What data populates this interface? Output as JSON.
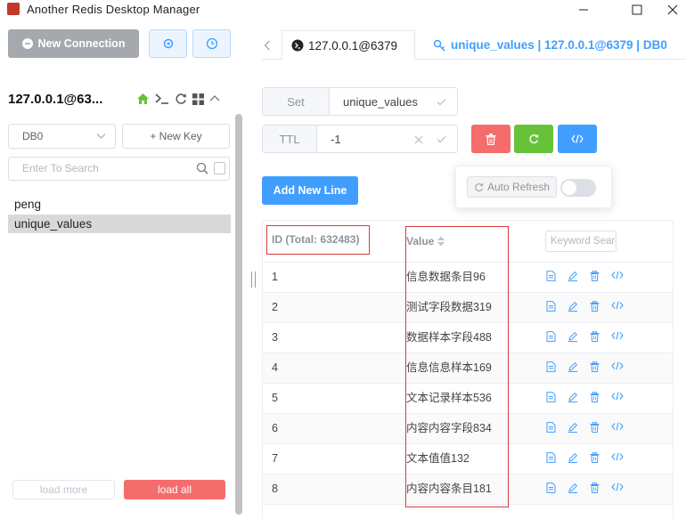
{
  "window": {
    "title": "Another Redis Desktop Manager"
  },
  "left": {
    "new_connection_label": "New Connection",
    "connection_name": "127.0.0.1@63...",
    "db_select": "DB0",
    "new_key_label": "+ New Key",
    "search_placeholder": "Enter To Search",
    "keys": [
      "peng",
      "unique_values"
    ],
    "load_more": "load more",
    "load_all": "load all"
  },
  "tabs": [
    {
      "label": "127.0.0.1@6379",
      "icon": "terminal-icon"
    },
    {
      "label": "unique_values | 127.0.0.1@6379 | DB0",
      "icon": "key-icon"
    }
  ],
  "key": {
    "type": "Set",
    "name": "unique_values",
    "ttl_label": "TTL",
    "ttl_value": "-1",
    "auto_refresh_label": "Auto Refresh",
    "add_new_line": "Add New Line"
  },
  "table": {
    "id_header": "ID (Total: 632483)",
    "value_header": "Value",
    "keyword_placeholder": "Keyword Search",
    "rows": [
      {
        "id": "1",
        "value": "信息数据条目96"
      },
      {
        "id": "2",
        "value": "测试字段数据319"
      },
      {
        "id": "3",
        "value": "数据样本字段488"
      },
      {
        "id": "4",
        "value": "信息信息样本169"
      },
      {
        "id": "5",
        "value": "文本记录样本536"
      },
      {
        "id": "6",
        "value": "内容内容字段834"
      },
      {
        "id": "7",
        "value": "文本值值132"
      },
      {
        "id": "8",
        "value": "内容内容条目181"
      }
    ]
  },
  "colors": {
    "primary": "#409eff",
    "danger": "#f56c6c",
    "success": "#67c23a",
    "highlight_box": "#d93a3a"
  }
}
